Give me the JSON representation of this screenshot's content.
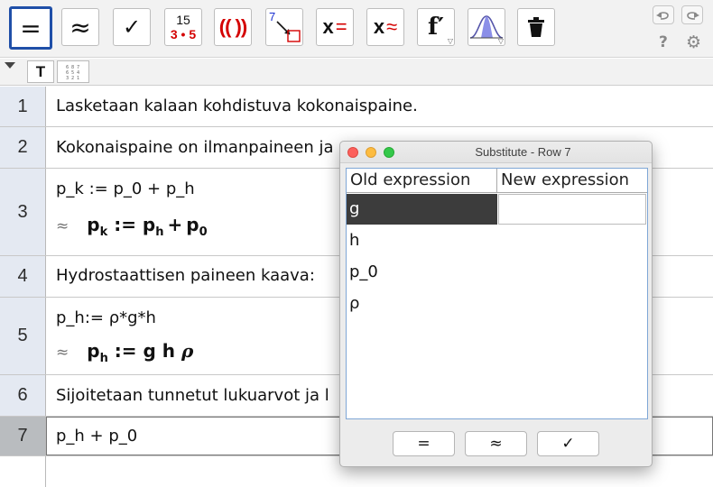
{
  "toolbar": {
    "tools": [
      {
        "name": "evaluate-tool",
        "label": "=",
        "active": true
      },
      {
        "name": "numeric-tool",
        "label": "≈"
      },
      {
        "name": "keep-input-tool",
        "label": "✓"
      },
      {
        "name": "factor-tool",
        "label_top": "15",
        "label_bottom": "3 • 5"
      },
      {
        "name": "expand-tool",
        "label": "(( ))"
      },
      {
        "name": "substitute-tool",
        "label": "7"
      },
      {
        "name": "solve-tool",
        "label_x": "x",
        "label_op": "="
      },
      {
        "name": "solve-numerically-tool",
        "label_x": "x",
        "label_op": "≈"
      },
      {
        "name": "derivative-tool",
        "label": "f′"
      },
      {
        "name": "probability-tool",
        "label": ""
      },
      {
        "name": "delete-tool",
        "label": ""
      }
    ],
    "help_icon": "?",
    "settings_icon": "⚙"
  },
  "subbar": {
    "text_button": "T",
    "table_button": "tabular-icon"
  },
  "rows": [
    {
      "num": "1",
      "input": "Lasketaan kalaan kohdistuva kokonaispaine."
    },
    {
      "num": "2",
      "input": "Kokonaispaine on ilmanpaineen ja"
    },
    {
      "num": "3",
      "input": "p_k := p_0 + p_h",
      "output_approx": "≈"
    },
    {
      "num": "4",
      "input": "Hydrostaattisen paineen kaava:"
    },
    {
      "num": "5",
      "input": "p_h:= ρ*g*h",
      "output_approx": "≈"
    },
    {
      "num": "6",
      "input": "Sijoitetaan tunnetut lukuarvot ja l"
    },
    {
      "num": "7",
      "input": "p_h + p_0"
    },
    {
      "num": "",
      "input": ""
    }
  ],
  "dialog": {
    "title": "Substitute - Row 7",
    "col_old": "Old expression",
    "col_new": "New expression",
    "items": [
      "g",
      "h",
      "p_0",
      "ρ"
    ],
    "btn_eq": "=",
    "btn_approx": "≈",
    "btn_check": "✓"
  }
}
